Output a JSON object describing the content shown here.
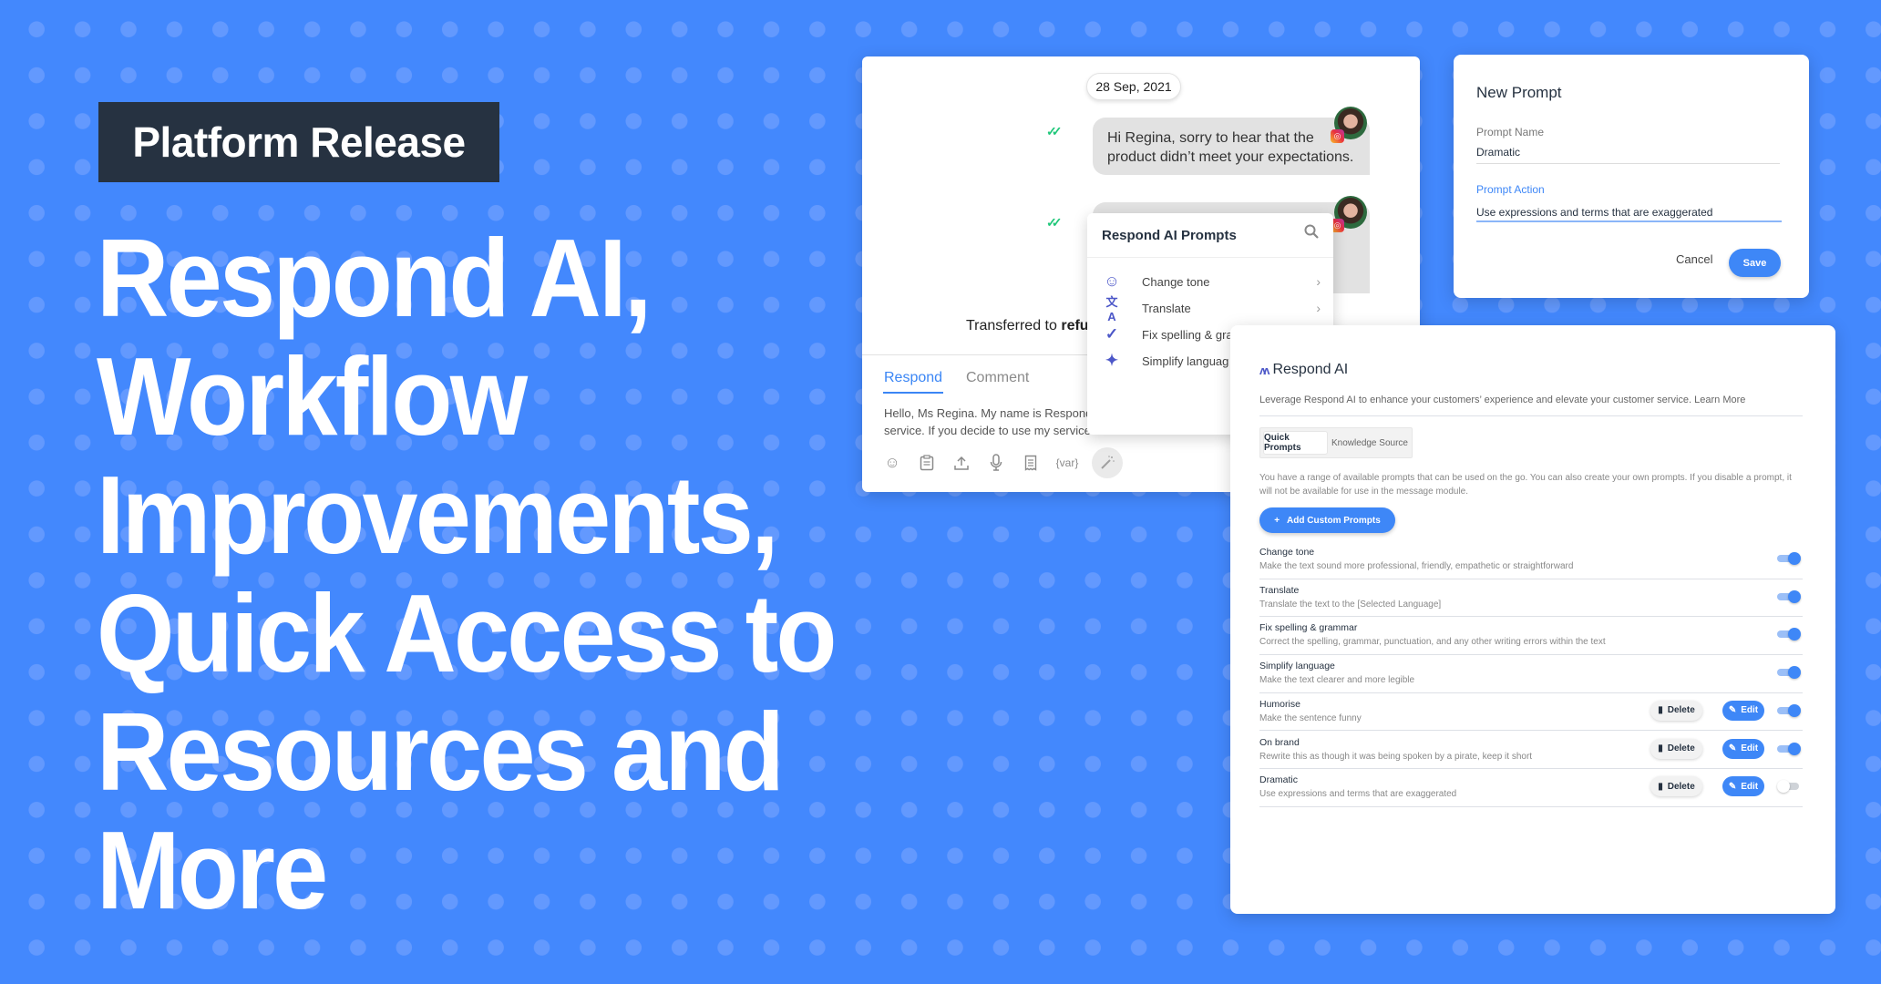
{
  "banner": {
    "badge": "Platform Release",
    "headline_lines": [
      "Respond AI,",
      "Workflow",
      "Improvements,",
      "Quick Access to",
      "Resources and",
      "More"
    ]
  },
  "colors": {
    "background": "#4388fd",
    "badge": "#263241",
    "accent": "#3e87f7",
    "icon_indigo": "#4c57c8",
    "read_check": "#20c77a"
  },
  "chat": {
    "date": "28 Sep, 2021",
    "messages": [
      {
        "text": "Hi Regina, sorry to hear that the product didn’t meet your expectations.",
        "status_icon": "double-check-icon",
        "channel_icon": "instagram-icon"
      },
      {
        "text": "",
        "status_icon": "double-check-icon",
        "channel_icon": "instagram-icon"
      }
    ],
    "transfer_prefix": "Transferred to ",
    "transfer_target": "refu",
    "tabs": [
      {
        "label": "Respond",
        "active": true
      },
      {
        "label": "Comment",
        "active": false
      }
    ],
    "compose_text": [
      "Hello, Ms Regina. My name is Respond",
      "service. If you decide to use my service"
    ],
    "toolbar": [
      {
        "icon": "emoji-icon",
        "glyph": "☺"
      },
      {
        "icon": "clipboard-icon",
        "glyph": "📋"
      },
      {
        "icon": "upload-icon",
        "glyph": "⇪"
      },
      {
        "icon": "microphone-icon",
        "glyph": "🎙"
      },
      {
        "icon": "receipt-icon",
        "glyph": "☰"
      },
      {
        "icon": "variable-icon",
        "glyph": "{var}"
      },
      {
        "icon": "magic-wand-icon",
        "glyph": "⁄"
      }
    ]
  },
  "prompts_dropdown": {
    "title": "Respond AI Prompts",
    "items": [
      {
        "label": "Change tone",
        "icon": "face-sparkle-icon",
        "glyph": "☺",
        "has_submenu": true
      },
      {
        "label": "Translate",
        "icon": "translate-icon",
        "glyph": "文A",
        "has_submenu": true
      },
      {
        "label": "Fix spelling & gra",
        "icon": "check-icon",
        "glyph": "✓",
        "has_submenu": false
      },
      {
        "label": "Simplify languag",
        "icon": "sparkle-icon",
        "glyph": "✦",
        "has_submenu": false
      }
    ]
  },
  "new_prompt": {
    "title": "New Prompt",
    "name_label": "Prompt Name",
    "name_value": "Dramatic",
    "action_label": "Prompt Action",
    "action_value": "Use expressions and terms that are exaggerated",
    "cancel": "Cancel",
    "save": "Save"
  },
  "respond_ai": {
    "title": "Respond AI",
    "description": "Leverage Respond AI to enhance your customers’ experience and elevate your customer service. Learn More",
    "tabs": [
      {
        "label": "Quick Prompts",
        "active": true
      },
      {
        "label": "Knowledge Source",
        "active": false
      }
    ],
    "info": "You have a range of available prompts that can be used on the go. You can also create your own prompts. If you disable a prompt, it will not be available for use in the message module.",
    "add_button": "Add Custom Prompts",
    "delete_label": "Delete",
    "edit_label": "Edit",
    "prompts": [
      {
        "name": "Change tone",
        "description": "Make the text sound more professional, friendly, empathetic or straightforward",
        "enabled": true,
        "custom": false
      },
      {
        "name": "Translate",
        "description": "Translate the text to the [Selected Language]",
        "enabled": true,
        "custom": false
      },
      {
        "name": "Fix spelling & grammar",
        "description": "Correct the spelling, grammar, punctuation, and any other writing errors within the text",
        "enabled": true,
        "custom": false
      },
      {
        "name": "Simplify language",
        "description": "Make the text clearer and more legible",
        "enabled": true,
        "custom": false
      },
      {
        "name": "Humorise",
        "description": "Make the sentence funny",
        "enabled": true,
        "custom": true
      },
      {
        "name": "On brand",
        "description": "Rewrite this as though it was being spoken by a pirate, keep it short",
        "enabled": true,
        "custom": true
      },
      {
        "name": "Dramatic",
        "description": "Use expressions and terms that are exaggerated",
        "enabled": false,
        "custom": true
      }
    ]
  }
}
